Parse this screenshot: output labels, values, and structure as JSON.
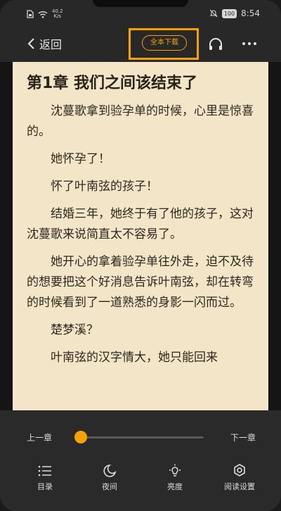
{
  "status": {
    "network_speed": "40.2",
    "network_unit": "K/s",
    "battery": "100",
    "time": "8:54"
  },
  "toolbar": {
    "back_label": "返回",
    "download_label": "全本下载"
  },
  "chapter": {
    "title": "第1章 我们之间该结束了",
    "paragraphs": [
      "沈蔓歌拿到验孕单的时候，心里是惊喜的。",
      "她怀孕了！",
      "怀了叶南弦的孩子！",
      "结婚三年，她终于有了他的孩子，这对沈蔓歌来说简直太不容易了。",
      "她开心的拿着验孕单往外走，迫不及待的想要把这个好消息告诉叶南弦，却在转弯的时候看到了一道熟悉的身影一闪而过。",
      "楚梦溪？",
      "叶南弦的汉字情大，她只能回来"
    ]
  },
  "bottom": {
    "prev_label": "上一章",
    "next_label": "下一章",
    "progress": 0.04,
    "nav": {
      "toc_label": "目录",
      "night_label": "夜间",
      "brightness_label": "亮度",
      "settings_label": "阅读设置"
    }
  },
  "colors": {
    "accent": "#f5a300",
    "paper": "#f3e6c8",
    "bar": "#282828"
  },
  "icons": {
    "back": "chevron-left-icon",
    "headphone": "headphone-icon",
    "more": "more-dots-icon",
    "toc": "list-icon",
    "night": "night-mode-icon",
    "brightness": "brightness-icon",
    "settings": "gear-icon"
  }
}
